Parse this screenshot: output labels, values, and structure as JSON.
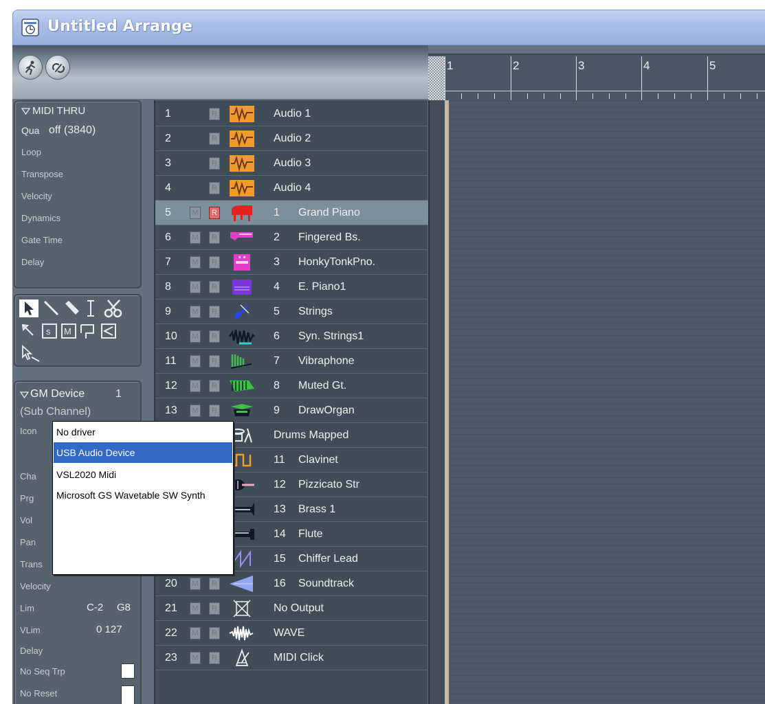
{
  "window": {
    "title": "Untitled Arrange"
  },
  "ruler": {
    "bars": [
      "1",
      "2",
      "3",
      "4",
      "5"
    ]
  },
  "thru_panel": {
    "header": "MIDI THRU",
    "qua_label": "Qua",
    "qua_value": "off (3840)",
    "params": [
      "Loop",
      "Transpose",
      "Velocity",
      "Dynamics",
      "Gate Time",
      "Delay"
    ]
  },
  "device_panel": {
    "header": "GM Device",
    "number": "1",
    "subtitle": "(Sub Channel)",
    "icon_label": "Icon",
    "labels": [
      "Cha",
      "Prg",
      "Vol",
      "Pan",
      "Trans",
      "Velocity",
      "Lim",
      "VLim",
      "Delay",
      "No Seq Trp",
      "No Reset"
    ],
    "lim_value": "C-2",
    "lim_value2": "G8",
    "vlim_value": "0 127"
  },
  "tracks": [
    {
      "num": "1",
      "name": "Audio 1"
    },
    {
      "num": "2",
      "name": "Audio 2"
    },
    {
      "num": "3",
      "name": "Audio 3"
    },
    {
      "num": "4",
      "name": "Audio 4"
    },
    {
      "num": "5",
      "channel": "1",
      "name": "Grand Piano",
      "selected": true,
      "record": true
    },
    {
      "num": "6",
      "channel": "2",
      "name": "Fingered Bs."
    },
    {
      "num": "7",
      "channel": "3",
      "name": "HonkyTonkPno."
    },
    {
      "num": "8",
      "channel": "4",
      "name": "E. Piano1"
    },
    {
      "num": "9",
      "channel": "5",
      "name": "Strings"
    },
    {
      "num": "10",
      "channel": "6",
      "name": "Syn. Strings1"
    },
    {
      "num": "11",
      "channel": "7",
      "name": "Vibraphone"
    },
    {
      "num": "12",
      "channel": "8",
      "name": "Muted Gt."
    },
    {
      "num": "13",
      "channel": "9",
      "name": "DrawOrgan"
    },
    {
      "num": "",
      "name": "Drums Mapped"
    },
    {
      "num": "",
      "channel": "11",
      "name": "Clavinet"
    },
    {
      "num": "",
      "channel": "12",
      "name": "Pizzicato Str"
    },
    {
      "num": "",
      "channel": "13",
      "name": "Brass 1"
    },
    {
      "num": "",
      "channel": "14",
      "name": "Flute"
    },
    {
      "num": "",
      "channel": "15",
      "name": "Chiffer Lead"
    },
    {
      "num": "20",
      "channel": "16",
      "name": "Soundtrack"
    },
    {
      "num": "21",
      "name": "No Output"
    },
    {
      "num": "22",
      "name": "WAVE"
    },
    {
      "num": "23",
      "name": "MIDI Click"
    }
  ],
  "button_labels": {
    "mute": "M",
    "record": "R"
  },
  "dropdown": {
    "items": [
      "No driver",
      "USB Audio Device",
      "VSL2020 Midi",
      "Microsoft GS Wavetable SW Synth"
    ],
    "selected_index": 1
  },
  "colors": {
    "title_bar": "#a8bde6",
    "selection": "#316ac5",
    "record_on": "#e36a6a",
    "audio_icon": "#f29a2e"
  }
}
